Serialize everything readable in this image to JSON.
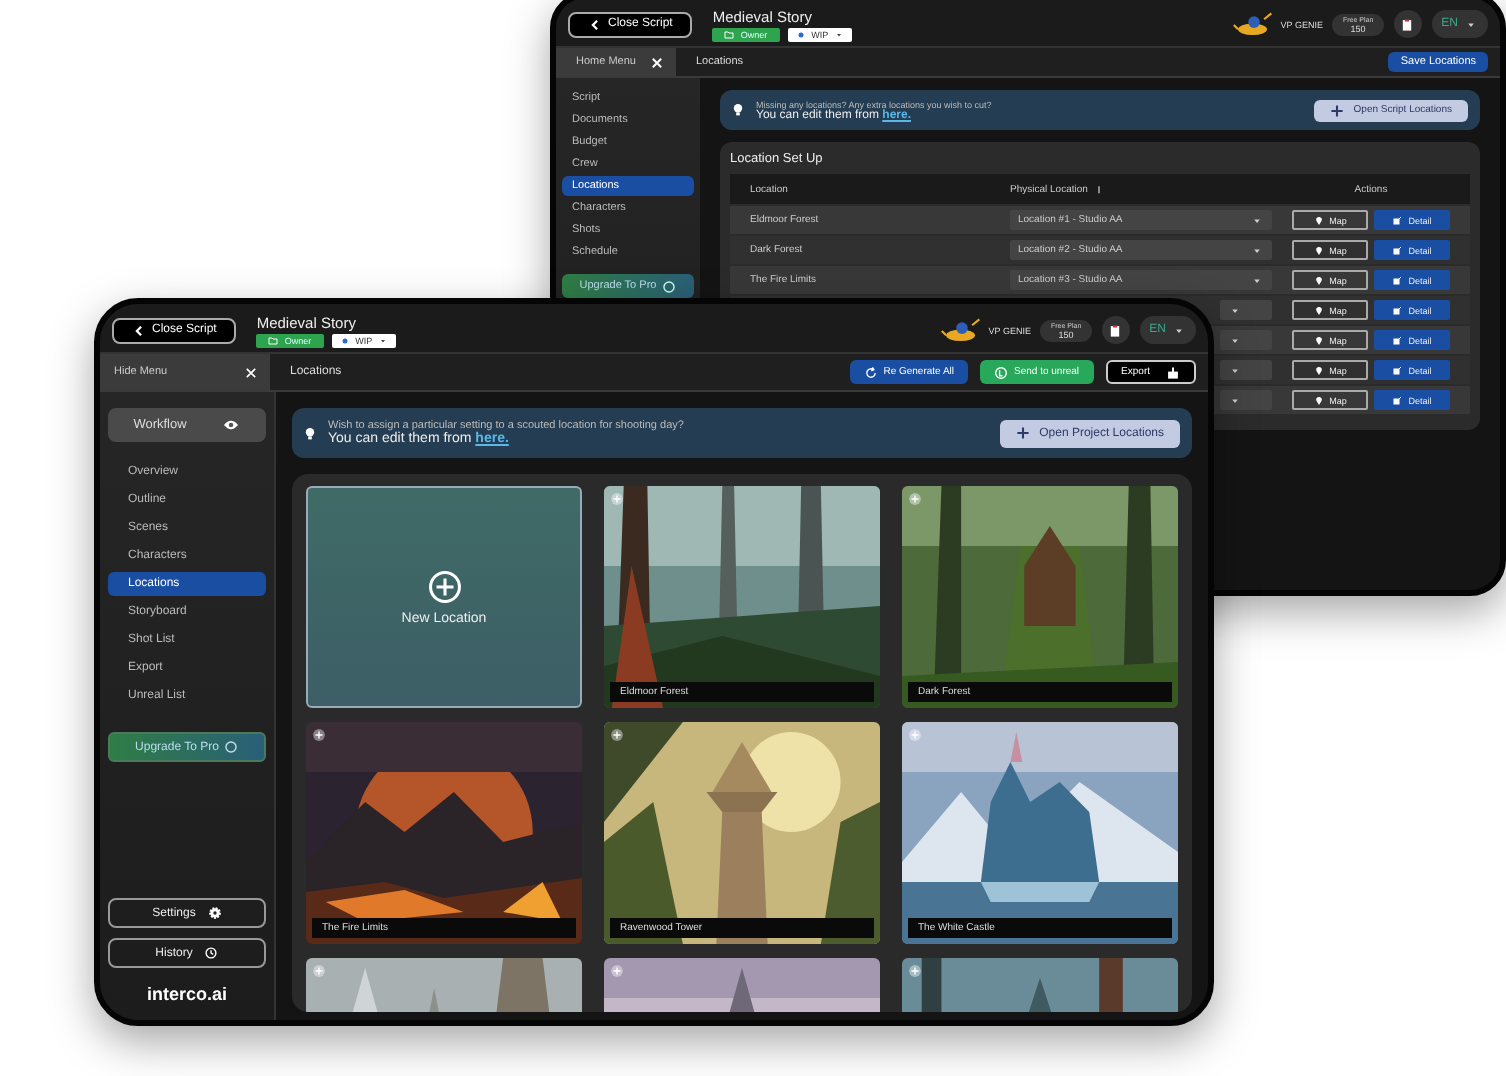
{
  "back_screen": {
    "header": {
      "close_button": "Close Script",
      "project_title": "Medieval Story",
      "role_badge": "Owner",
      "status_dropdown": "WIP",
      "genie_label": "VP GENIE",
      "plan_label": "Free Plan",
      "credits": "150",
      "user_initials": "EN"
    },
    "menu_toggle": "Home Menu",
    "page_title": "Locations",
    "save_button": "Save Locations",
    "sidebar": {
      "items": [
        {
          "label": "Script",
          "selected": false
        },
        {
          "label": "Documents",
          "selected": false
        },
        {
          "label": "Budget",
          "selected": false
        },
        {
          "label": "Crew",
          "selected": false
        },
        {
          "label": "Locations",
          "selected": true
        },
        {
          "label": "Characters",
          "selected": false
        },
        {
          "label": "Shots",
          "selected": false
        },
        {
          "label": "Schedule",
          "selected": false
        }
      ],
      "upgrade_button": "Upgrade To Pro"
    },
    "banner": {
      "question": "Missing any locations? Any extra locations you wish to cut?",
      "prompt": "You can edit them from",
      "link": "here.",
      "button": "Open Script Locations"
    },
    "table": {
      "title": "Location Set Up",
      "columns": [
        "Location",
        "Physical Location",
        "Actions"
      ],
      "rows": [
        {
          "location": "Eldmoor Forest",
          "physical_location": "Location #1 - Studio AA",
          "map_button": "Map",
          "detail_button": "Detail"
        },
        {
          "location": "Dark Forest",
          "physical_location": "Location #2 - Studio AA",
          "map_button": "Map",
          "detail_button": "Detail"
        },
        {
          "location": "The Fire Limits",
          "physical_location": "Location #3 - Studio AA",
          "map_button": "Map",
          "detail_button": "Detail"
        },
        {
          "map_button": "Map",
          "detail_button": "Detail"
        },
        {
          "map_button": "Map",
          "detail_button": "Detail"
        },
        {
          "map_button": "Map",
          "detail_button": "Detail"
        },
        {
          "map_button": "Map",
          "detail_button": "Detail"
        }
      ]
    }
  },
  "front_screen": {
    "header": {
      "close_button": "Close Script",
      "project_title": "Medieval Story",
      "role_badge": "Owner",
      "status_dropdown": "WIP",
      "genie_label": "VP GENIE",
      "plan_label": "Free Plan",
      "credits": "150",
      "user_initials": "EN"
    },
    "menu_toggle": "Hide  Menu",
    "page_title": "Locations",
    "toolbar": {
      "regenerate_button": "Re Generate All",
      "unreal_button": "Send to unreal",
      "export_button": "Export"
    },
    "sidebar": {
      "workflow_button": "Workflow",
      "items": [
        {
          "label": "Overview",
          "selected": false
        },
        {
          "label": "Outline",
          "selected": false
        },
        {
          "label": "Scenes",
          "selected": false
        },
        {
          "label": "Characters",
          "selected": false
        },
        {
          "label": "Locations",
          "selected": true
        },
        {
          "label": "Storyboard",
          "selected": false
        },
        {
          "label": "Shot List",
          "selected": false
        },
        {
          "label": "Export",
          "selected": false
        },
        {
          "label": "Unreal List",
          "selected": false
        }
      ],
      "upgrade_button": "Upgrade To Pro",
      "settings_button": "Settings",
      "history_button": "History",
      "logo": "interco.ai"
    },
    "banner": {
      "question": "Wish to assign a particular setting to a scouted location for shooting day?",
      "prompt": "You can edit them from",
      "link": "here.",
      "button": "Open Project Locations"
    },
    "new_tile": "New Location",
    "tiles": [
      {
        "kind": "picture",
        "label": "Eldmoor Forest"
      },
      {
        "kind": "picture",
        "label": "Dark Forest"
      },
      {
        "kind": "picture",
        "label": "The Fire Limits"
      },
      {
        "kind": "picture",
        "label": "Ravenwood Tower"
      },
      {
        "kind": "picture",
        "label": "The White Castle"
      },
      {
        "kind": "picture"
      },
      {
        "kind": "picture"
      },
      {
        "kind": "picture"
      }
    ]
  }
}
